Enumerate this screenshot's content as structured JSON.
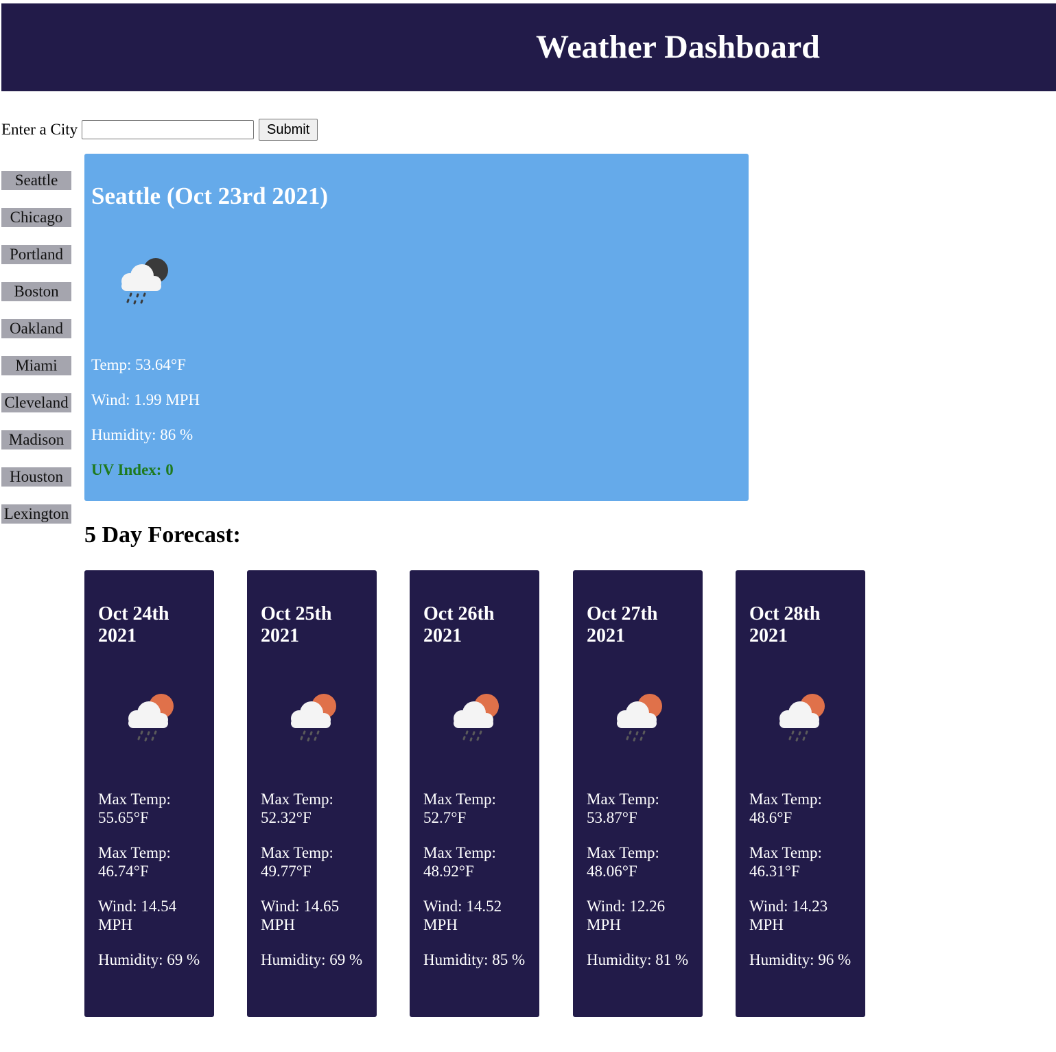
{
  "header": {
    "title": "Weather Dashboard"
  },
  "search": {
    "label": "Enter a City",
    "value": "",
    "placeholder": "",
    "submit_label": "Submit"
  },
  "history": [
    "Seattle",
    "Chicago",
    "Portland",
    "Boston",
    "Oakland",
    "Miami",
    "Cleveland",
    "Madison",
    "Houston",
    "Lexington"
  ],
  "current": {
    "title": "Seattle (Oct 23rd 2021)",
    "icon": "rain-cloud-night-icon",
    "temp": "Temp: 53.64°F",
    "wind": "Wind: 1.99 MPH",
    "humidity": "Humidity: 86 %",
    "uv": "UV Index: 0",
    "uv_color": "#1f7a1f",
    "background": "#65aaea"
  },
  "forecast": {
    "heading": "5 Day Forecast:",
    "card_color": "#221b49",
    "days": [
      {
        "date": "Oct 24th 2021",
        "icon": "rain-cloud-sun-icon",
        "max": "Max Temp: 55.65°F",
        "min": "Max Temp: 46.74°F",
        "wind": "Wind: 14.54 MPH",
        "humidity": "Humidity: 69 %"
      },
      {
        "date": "Oct 25th 2021",
        "icon": "rain-cloud-sun-icon",
        "max": "Max Temp: 52.32°F",
        "min": "Max Temp: 49.77°F",
        "wind": "Wind: 14.65 MPH",
        "humidity": "Humidity: 69 %"
      },
      {
        "date": "Oct 26th 2021",
        "icon": "rain-cloud-sun-icon",
        "max": "Max Temp: 52.7°F",
        "min": "Max Temp: 48.92°F",
        "wind": "Wind: 14.52 MPH",
        "humidity": "Humidity: 85 %"
      },
      {
        "date": "Oct 27th 2021",
        "icon": "rain-cloud-sun-icon",
        "max": "Max Temp: 53.87°F",
        "min": "Max Temp: 48.06°F",
        "wind": "Wind: 12.26 MPH",
        "humidity": "Humidity: 81 %"
      },
      {
        "date": "Oct 28th 2021",
        "icon": "rain-cloud-sun-icon",
        "max": "Max Temp: 48.6°F",
        "min": "Max Temp: 46.31°F",
        "wind": "Wind: 14.23 MPH",
        "humidity": "Humidity: 96 %"
      }
    ]
  }
}
